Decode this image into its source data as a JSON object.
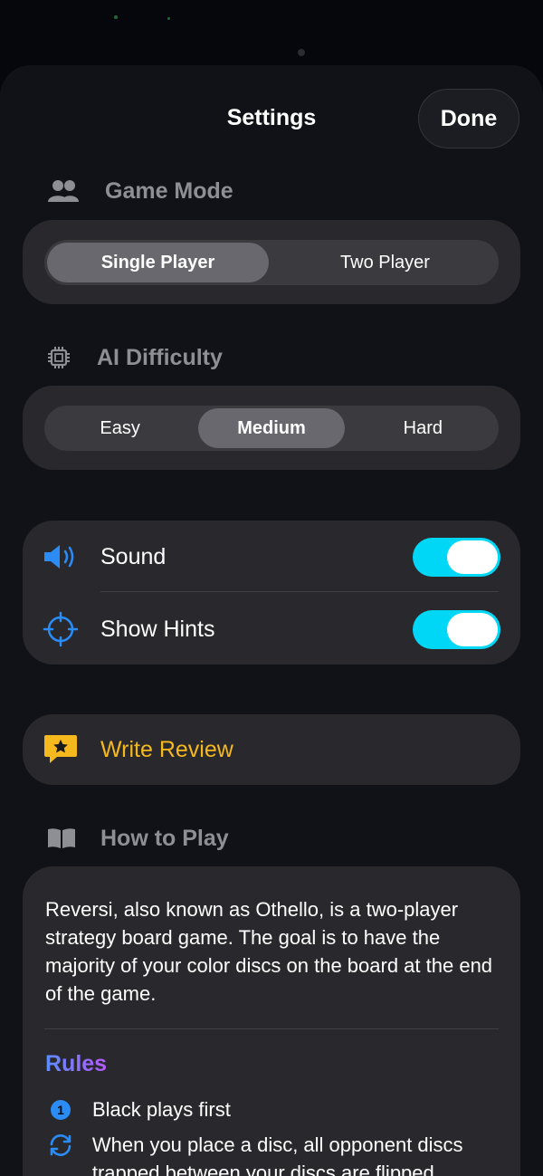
{
  "nav": {
    "title": "Settings",
    "done_label": "Done"
  },
  "game_mode": {
    "title": "Game Mode",
    "options": [
      "Single Player",
      "Two Player"
    ],
    "selected": "Single Player"
  },
  "ai_difficulty": {
    "title": "AI Difficulty",
    "options": [
      "Easy",
      "Medium",
      "Hard"
    ],
    "selected": "Medium"
  },
  "toggles": {
    "sound": {
      "label": "Sound",
      "on": true
    },
    "hints": {
      "label": "Show Hints",
      "on": true
    }
  },
  "review": {
    "label": "Write Review"
  },
  "how_to_play": {
    "title": "How to Play",
    "intro": "Reversi, also known as Othello, is a two-player strategy board game. The goal is to have the majority of your color discs on the board at the end of the game.",
    "rules_title": "Rules",
    "rules": [
      {
        "number": "1",
        "text": "Black plays first"
      },
      {
        "number": "",
        "text": "When you place a disc, all opponent discs trapped between your discs are flipped"
      }
    ]
  },
  "colors": {
    "accent_cyan": "#00d7f7",
    "review_yellow": "#f5b81d",
    "icon_blue": "#2a8cf4",
    "card_bg": "#29292d"
  }
}
